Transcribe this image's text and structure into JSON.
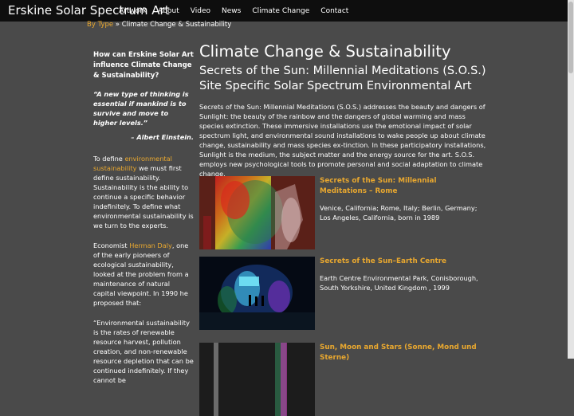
{
  "header": {
    "site_title": "Erskine Solar Spectrum Art",
    "nav": [
      "Artwork",
      "About",
      "Video",
      "News",
      "Climate Change",
      "Contact"
    ]
  },
  "breadcrumb": {
    "link": "By Type",
    "separator": "»",
    "current": "Climate Change & Sustainability"
  },
  "sidebar": {
    "question": "How can Erskine Solar Art influence Climate Change & Sustainability?",
    "quote": "“A new type of thinking is essential if mankind is to survive and move to higher levels.”",
    "author": "– Albert Einstein.",
    "p1_before": "To define ",
    "p1_link": "environmental sustainability",
    "p1_after": " we must first define sustainability. Sustainability is the ability to continue a specific behavior indefinitely. To define what environmental sustainability is we turn to the experts.",
    "p2_before": "Economist ",
    "p2_link": "Herman Daly",
    "p2_after": ", one of the early pioneers of ecological sustainability, looked at the problem from a maintenance of natural capital viewpoint. In 1990 he proposed that:",
    "p3": "“Environmental sustainability is the rates of renewable resource harvest, pollution creation, and non-renewable resource depletion that can be continued indefinitely. If they cannot be"
  },
  "main": {
    "title": "Climate Change & Sustainability",
    "subtitle": "Secrets of the Sun: Millennial Meditations (S.O.S.) Site Specific Solar Spectrum Environmental Art",
    "intro": "Secrets of the Sun: Millennial Meditations (S.O.S.) addresses the beauty and dangers of Sunlight: the beauty of the rainbow and the dangers of global warming and mass species extinction. These immersive installations use the emotional impact of solar spectrum light, and environmental sound installations to wake people up about climate change, sustainability and mass species ex-tinction. In these participatory installations, Sunlight is the medium, the subject matter and the energy source for the art. S.O.S. employs new psychological tools to promote personal and social adaptation to climate change."
  },
  "items": [
    {
      "title": "Secrets of the Sun: Millennial Meditations – Rome",
      "desc": "Venice, California; Rome, Italy; Berlin, Germany; Los Angeles, California, born in 1989"
    },
    {
      "title": "Secrets of the Sun–Earth Centre",
      "desc": "Earth Centre Environmental Park, Conisborough, South Yorkshire, United Kingdom , 1999"
    },
    {
      "title": "Sun, Moon and Stars (Sonne, Mond und Sterne)",
      "desc": ""
    }
  ]
}
